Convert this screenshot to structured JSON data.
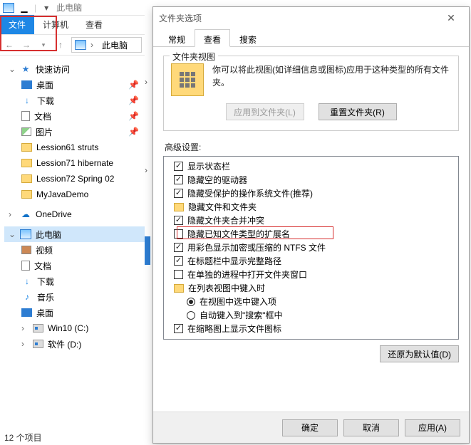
{
  "qat": {
    "title": "此电脑"
  },
  "ribbon": {
    "file": "文件",
    "t1": "计算机",
    "t2": "查看"
  },
  "addr": {
    "location": "此电脑"
  },
  "tree": {
    "quick": "快速访问",
    "desktop": "桌面",
    "downloads": "下载",
    "documents": "文档",
    "pictures": "图片",
    "f1": "Lession61 struts",
    "f2": "Lession71 hibernate",
    "f3": "Lession72 Spring 02",
    "f4": "MyJavaDemo",
    "onedrive": "OneDrive",
    "thispc": "此电脑",
    "videos": "视频",
    "docs2": "文档",
    "dl2": "下载",
    "music": "音乐",
    "desk2": "桌面",
    "c": "Win10 (C:)",
    "d": "软件 (D:)"
  },
  "status": "12 个项目",
  "dialog": {
    "title": "文件夹选项",
    "tabs": {
      "general": "常规",
      "view": "查看",
      "search": "搜索"
    },
    "group_legend": "文件夹视图",
    "fv_text1": "你可以将此视图(如详细信息或图标)应用于这种类型的所有文件夹。",
    "apply_folders": "应用到文件夹(L)",
    "reset_folders": "重置文件夹(R)",
    "adv_label": "高级设置:",
    "items": {
      "i0": "显示状态栏",
      "i1": "隐藏空的驱动器",
      "i2": "隐藏受保护的操作系统文件(推荐)",
      "i3": "隐藏文件和文件夹",
      "i4": "隐藏文件夹合并冲突",
      "i5": "隐藏已知文件类型的扩展名",
      "i6": "用彩色显示加密或压缩的 NTFS 文件",
      "i7": "在标题栏中显示完整路径",
      "i8": "在单独的进程中打开文件夹窗口",
      "i9": "在列表视图中键入时",
      "i10": "在视图中选中键入项",
      "i11": "自动键入到\"搜索\"框中",
      "i12": "在缩略图上显示文件图标"
    },
    "restore": "还原为默认值(D)",
    "ok": "确定",
    "cancel": "取消",
    "apply": "应用(A)"
  }
}
